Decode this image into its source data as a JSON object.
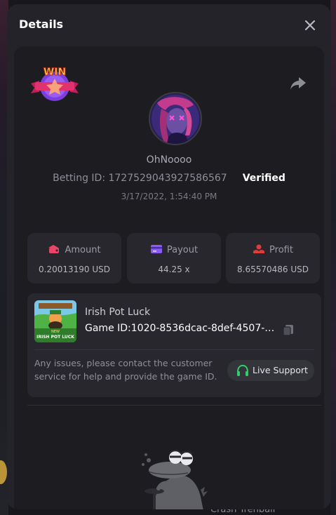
{
  "modal": {
    "title": "Details",
    "close_icon": "close-icon"
  },
  "bet": {
    "badge_text": "WIN",
    "share_icon": "share-icon",
    "username": "OhNoooo",
    "betting_id": "Betting ID: 1727529043927586567",
    "verified_label": "Verified",
    "timestamp": "3/17/2022, 1:54:40 PM"
  },
  "stats": [
    {
      "label": "Amount",
      "value": "0.20013190 USD",
      "icon": "wallet-icon",
      "icon_color": "#e8456b"
    },
    {
      "label": "Payout",
      "value": "44.25 x",
      "icon": "card-icon",
      "icon_color": "#8a5cf6"
    },
    {
      "label": "Profit",
      "value": "8.65570486 USD",
      "icon": "profit-icon",
      "icon_color": "#e23b3b"
    }
  ],
  "game": {
    "thumb_text": "IRISH POT LUCK",
    "name": "Irish Pot Luck",
    "game_id": "Game ID:1020-8536dcac-8def-4507-b...",
    "copy_icon": "copy-icon",
    "support_note": "Any issues, please contact the customer service for help and provide the game ID.",
    "live_support_label": "Live Support",
    "support_icon": "headset-icon",
    "support_icon_color": "#2fcf6a"
  },
  "background": {
    "bottom_text": "Crash Trenball"
  },
  "colors": {
    "modal_bg": "#232329",
    "content_bg": "#1c1c21",
    "card_bg": "#27272d",
    "verified": "#ffffff"
  }
}
